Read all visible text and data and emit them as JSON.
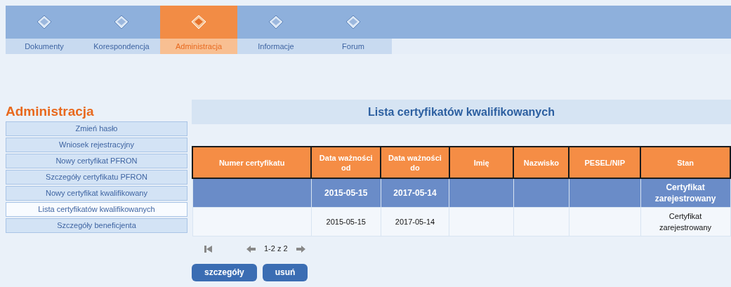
{
  "tabs": [
    {
      "label": "Dokumenty",
      "selected": false
    },
    {
      "label": "Korespondencja",
      "selected": false
    },
    {
      "label": "Administracja",
      "selected": true
    },
    {
      "label": "Informacje",
      "selected": false
    },
    {
      "label": "Forum",
      "selected": false
    }
  ],
  "sidebar": {
    "title": "Administracja",
    "items": [
      {
        "label": "Zmień hasło",
        "selected": false
      },
      {
        "label": "Wniosek rejestracyjny",
        "selected": false
      },
      {
        "label": "Nowy certyfikat PFRON",
        "selected": false
      },
      {
        "label": "Szczegóły certyfikatu PFRON",
        "selected": false
      },
      {
        "label": "Nowy certyfikat kwalifikowany",
        "selected": false
      },
      {
        "label": "Lista certyfikatów kwalifikowanych",
        "selected": true
      },
      {
        "label": "Szczegóły beneficjenta",
        "selected": false
      }
    ]
  },
  "main": {
    "title": "Lista certyfikatów kwalifikowanych",
    "table": {
      "columns": [
        "Numer certyfikatu",
        "Data ważności od",
        "Data ważności do",
        "Imię",
        "Nazwisko",
        "PESEL/NIP",
        "Stan"
      ],
      "rows": [
        {
          "selected": true,
          "cells": [
            "",
            "2015-05-15",
            "2017-05-14",
            "",
            "",
            "",
            "Certyfikat zarejestrowany"
          ]
        },
        {
          "selected": false,
          "cells": [
            "",
            "2015-05-15",
            "2017-05-14",
            "",
            "",
            "",
            "Certyfikat zarejestrowany"
          ]
        }
      ]
    },
    "pagination": {
      "range": "1-2 z 2"
    },
    "buttons": [
      "szczegóły",
      "usuń"
    ]
  }
}
